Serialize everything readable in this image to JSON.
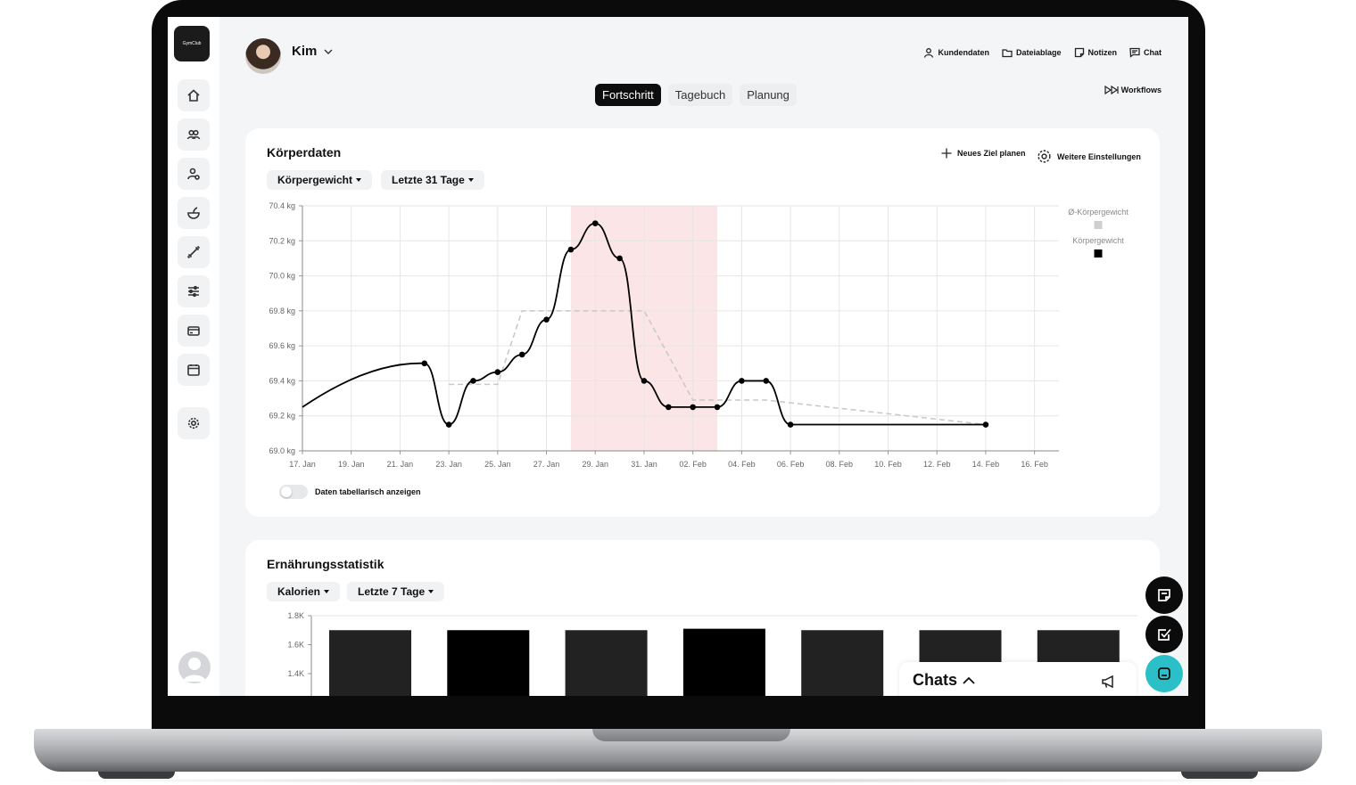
{
  "app": {
    "logo_text": "GymClub"
  },
  "header": {
    "user_name": "Kim",
    "links": [
      "Kundendaten",
      "Dateiablage",
      "Notizen",
      "Chat"
    ],
    "tabs": [
      "Fortschritt",
      "Tagebuch",
      "Planung"
    ],
    "active_tab": "Fortschritt",
    "workflows_label": "Workflows"
  },
  "sidebar": {
    "items": [
      "home-icon",
      "users-icon",
      "user-settings-icon",
      "nutrition-icon",
      "dumbbell-icon",
      "sliders-icon",
      "card-icon",
      "calendar-icon",
      "settings-icon"
    ]
  },
  "body_card": {
    "title": "Körperdaten",
    "metric_dropdown": "Körpergewicht",
    "range_dropdown": "Letzte 31 Tage",
    "new_goal_label": "Neues Ziel planen",
    "settings_label": "Weitere Einstellungen",
    "table_toggle_label": "Daten tabellarisch anzeigen"
  },
  "nutrition_card": {
    "title": "Ernährungsstatistik",
    "metric_dropdown": "Kalorien",
    "range_dropdown": "Letzte 7 Tage"
  },
  "chats": {
    "label": "Chats"
  },
  "colors": {
    "accent": "#0d0d0d",
    "highlight": "#fbe5e7",
    "chat_fab": "#2bc0c8",
    "avg_line": "#c7c7c7"
  },
  "chart_data": [
    {
      "type": "line",
      "title": "",
      "x_tick_labels": [
        "17. Jan",
        "19. Jan",
        "21. Jan",
        "23. Jan",
        "25. Jan",
        "27. Jan",
        "29. Jan",
        "31. Jan",
        "02. Feb",
        "04. Feb",
        "06. Feb",
        "08. Feb",
        "10. Feb",
        "12. Feb",
        "14. Feb",
        "16. Feb"
      ],
      "y_tick_labels": [
        "70.4 kg",
        "70.2 kg",
        "70.0 kg",
        "69.8 kg",
        "69.6 kg",
        "69.4 kg",
        "69.2 kg",
        "69.0 kg"
      ],
      "ylim": [
        69.0,
        70.4
      ],
      "xlim": [
        "2024-01-17",
        "2024-02-17"
      ],
      "highlight_range": [
        "2024-01-28",
        "2024-02-03"
      ],
      "legend": [
        "Ø-Körpergewicht",
        "Körpergewicht"
      ],
      "legend_position": "top-right",
      "grid": true,
      "series": [
        {
          "name": "Körpergewicht",
          "color": "#000000",
          "points": [
            [
              "2024-01-17",
              69.25
            ],
            [
              "2024-01-22",
              69.5
            ],
            [
              "2024-01-23",
              69.15
            ],
            [
              "2024-01-24",
              69.4
            ],
            [
              "2024-01-25",
              69.45
            ],
            [
              "2024-01-26",
              69.55
            ],
            [
              "2024-01-27",
              69.75
            ],
            [
              "2024-01-28",
              70.15
            ],
            [
              "2024-01-29",
              70.3
            ],
            [
              "2024-01-30",
              70.1
            ],
            [
              "2024-01-31",
              69.4
            ],
            [
              "2024-02-01",
              69.25
            ],
            [
              "2024-02-02",
              69.25
            ],
            [
              "2024-02-03",
              69.25
            ],
            [
              "2024-02-04",
              69.4
            ],
            [
              "2024-02-05",
              69.4
            ],
            [
              "2024-02-06",
              69.15
            ],
            [
              "2024-02-14",
              69.15
            ]
          ],
          "markers_from_index": 1
        },
        {
          "name": "Ø-Körpergewicht",
          "color": "#c7c7c7",
          "dashed": true,
          "points": [
            [
              "2024-01-23",
              69.38
            ],
            [
              "2024-01-25",
              69.38
            ],
            [
              "2024-01-26",
              69.8
            ],
            [
              "2024-01-31",
              69.8
            ],
            [
              "2024-02-02",
              69.29
            ],
            [
              "2024-02-05",
              69.29
            ],
            [
              "2024-02-14",
              69.15
            ]
          ]
        }
      ]
    },
    {
      "type": "bar",
      "title": "",
      "y_tick_labels": [
        "1.8K",
        "1.6K",
        "1.4K"
      ],
      "ylim": [
        1200,
        1800
      ],
      "categories_visible": false,
      "values": [
        1700,
        1700,
        1700,
        1710,
        1700,
        1700,
        1700
      ],
      "colors": [
        "#222222",
        "#000000",
        "#222222",
        "#000000",
        "#222222",
        "#222222",
        "#222222"
      ]
    }
  ]
}
